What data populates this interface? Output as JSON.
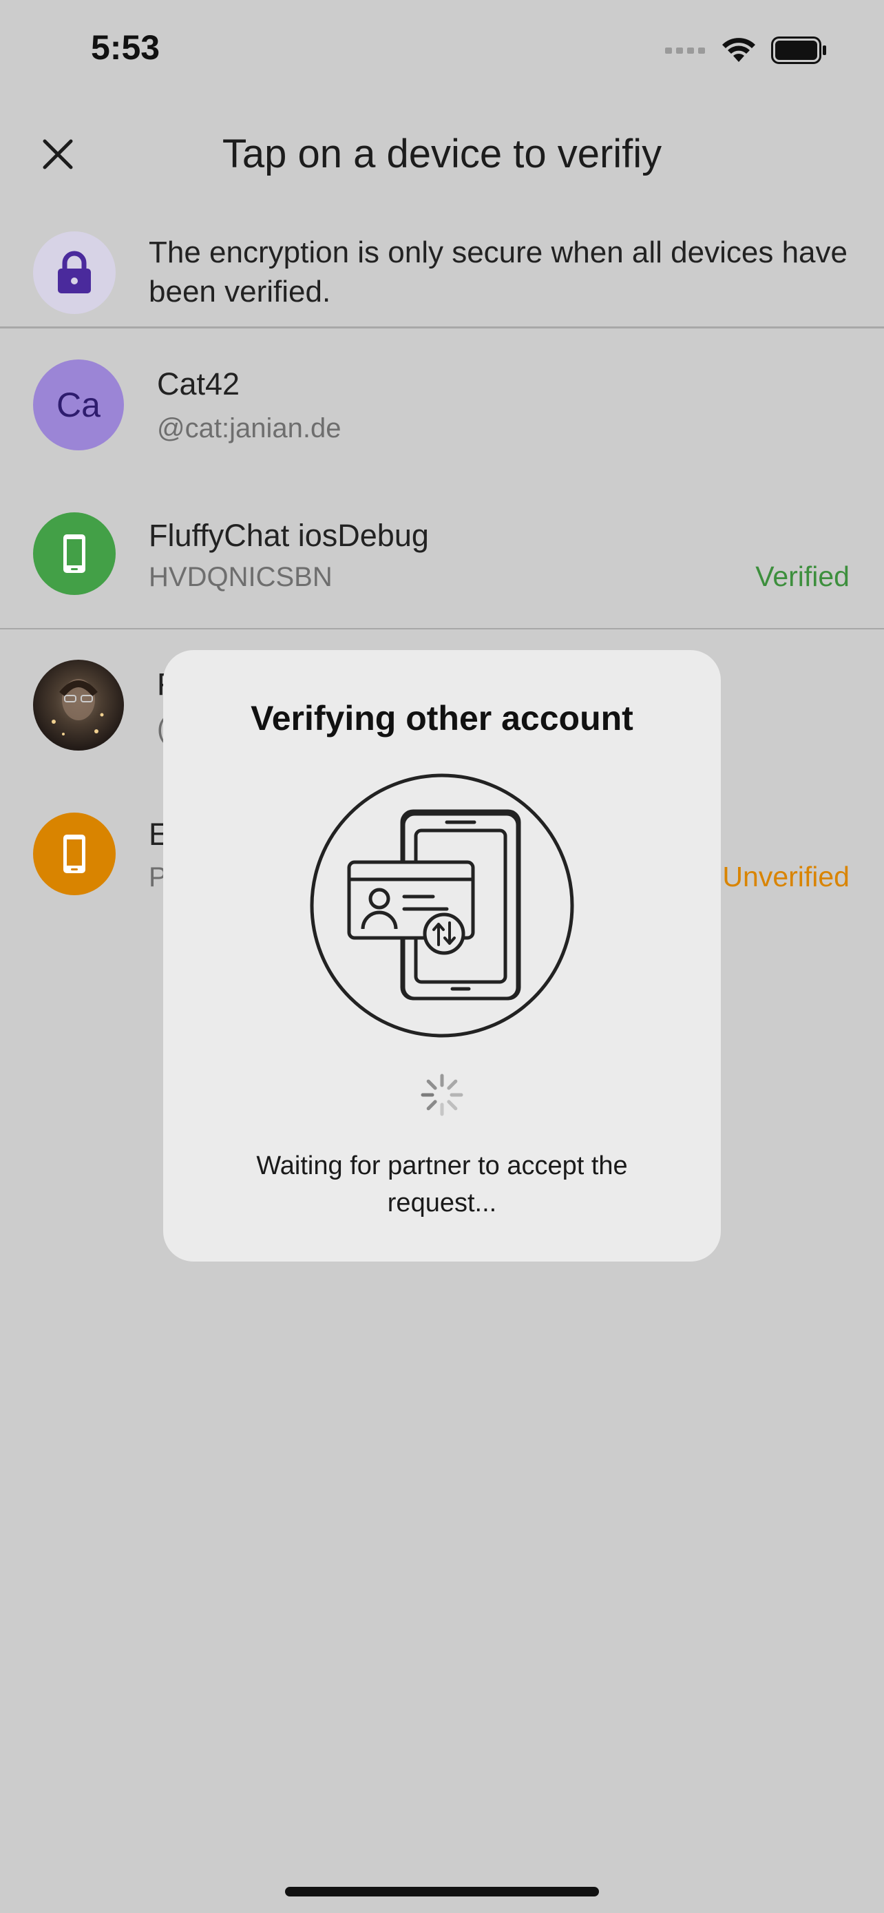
{
  "status_bar": {
    "time": "5:53",
    "icons": [
      "signal-icon",
      "wifi-icon",
      "battery-icon"
    ]
  },
  "app_bar": {
    "title": "Tap on a device to verifiy",
    "close_icon": "close-icon"
  },
  "notice": {
    "text": "The encryption is only secure when all devices have been verified.",
    "icon": "lock-icon",
    "icon_bg": "#d7d3e6",
    "icon_color": "#4a2a9c"
  },
  "users": [
    {
      "avatar_initials": "Ca",
      "avatar_color": "#9b85d6",
      "display_name": "Cat42",
      "user_id": "@cat:janian.de",
      "devices": [
        {
          "name": "FluffyChat iosDebug",
          "device_id": "HVDQNICSBN",
          "status": "Verified",
          "status_color": "#3d8f3d",
          "icon_color": "#43a047"
        }
      ]
    },
    {
      "display_name_visible": "F",
      "user_id_visible": "(",
      "avatar": "photo-avatar",
      "devices": [
        {
          "name_visible": "E",
          "device_id_visible": "P",
          "status": "Unverified",
          "status_color": "#d98400",
          "icon_color": "#d98400"
        }
      ]
    }
  ],
  "dialog": {
    "title": "Verifying other account",
    "illustration": "device-verification-illustration",
    "spinner": "loading-spinner-icon",
    "message": "Waiting for partner to accept the request..."
  },
  "colors": {
    "overlay_bg": "#cccccc",
    "dialog_bg": "#ebebeb"
  }
}
